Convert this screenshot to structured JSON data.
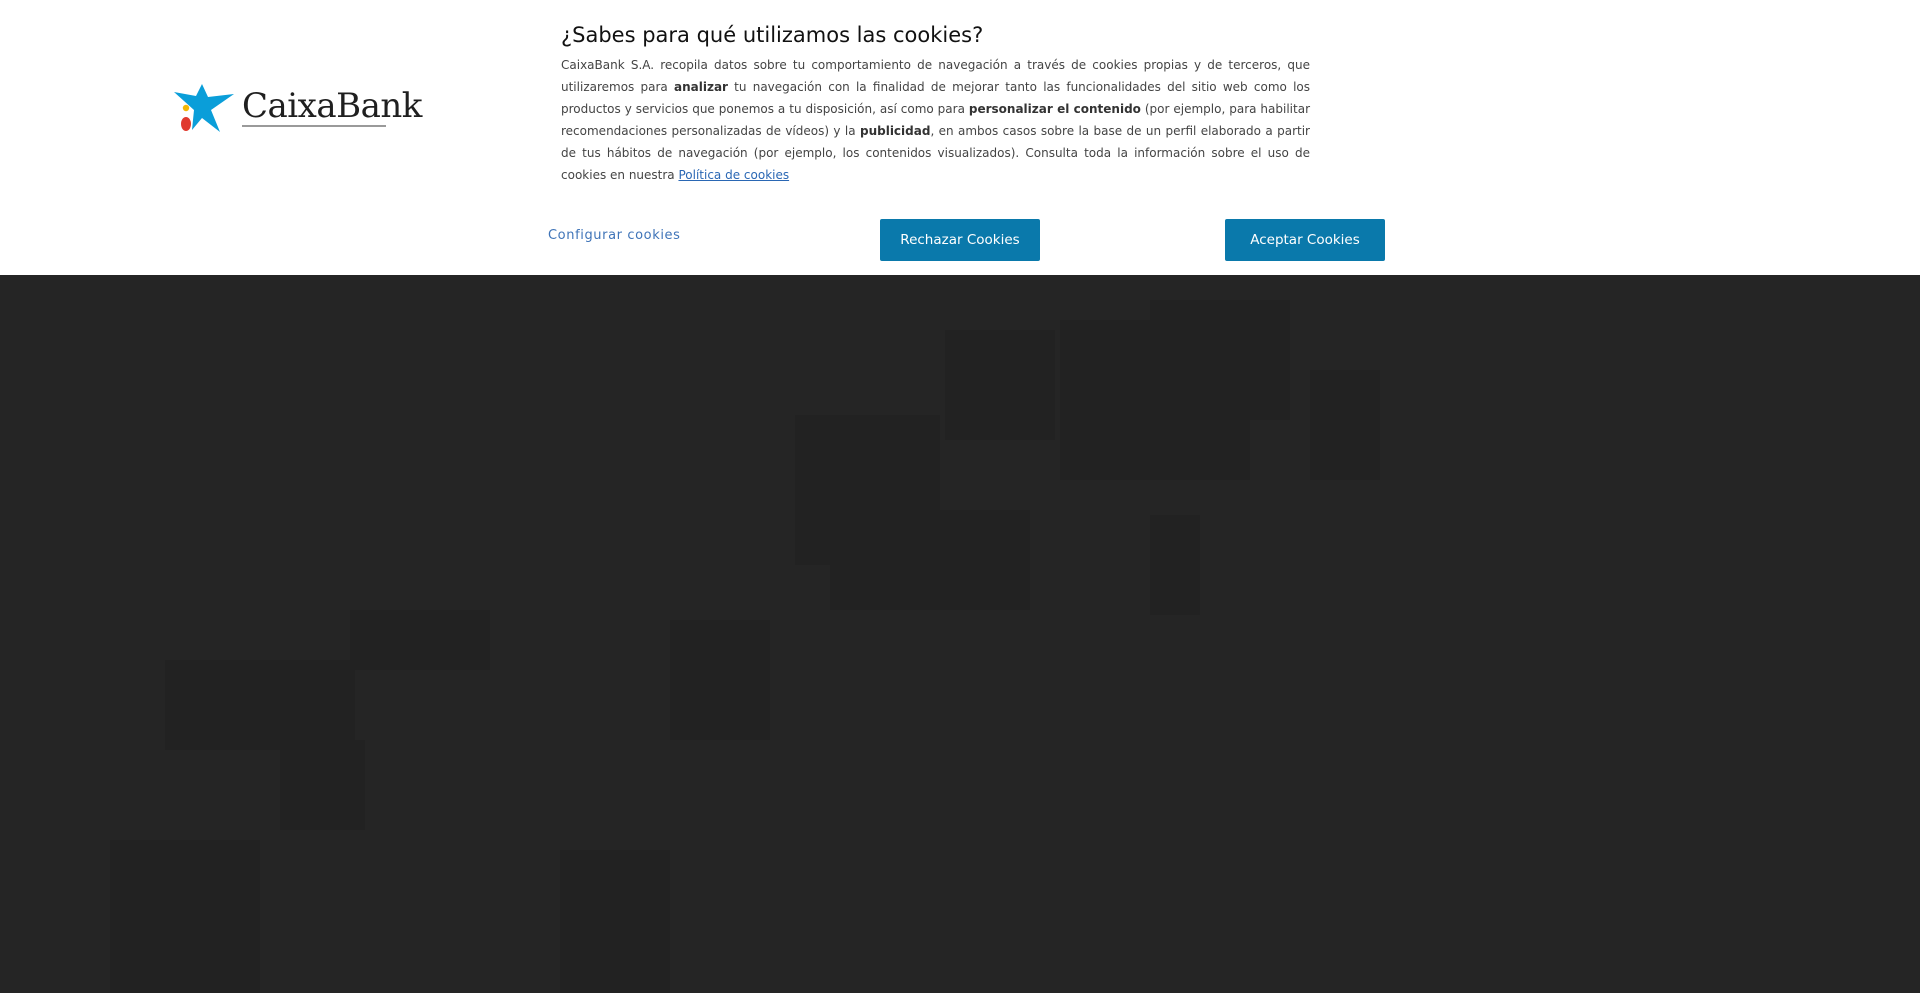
{
  "brand": {
    "name": "CaixaBank",
    "star_color": "#0a9ed9",
    "dot_red": "#e03a2e",
    "dot_yellow": "#f2b705",
    "dot_blue": "#0a9ed9"
  },
  "cookie_banner": {
    "title": "¿Sabes para qué utilizamos las cookies?",
    "description": {
      "p1": "CaixaBank S.A. recopila datos sobre tu comportamiento de navegación a través de cookies propias y de terceros, que utilizaremos para ",
      "b1": "analizar",
      "p2": " tu navegación con la finalidad de mejorar tanto las funcionalidades del sitio web como los productos y servicios que ponemos a tu disposición, así como para ",
      "b2": "personalizar el contenido",
      "p3": " (por ejemplo, para habilitar recomendaciones personalizadas de vídeos) y la ",
      "b3": "publicidad",
      "p4": ", en ambos casos sobre la base de un perfil elaborado a partir de tus hábitos de navegación (por ejemplo, los contenidos visualizados). Consulta toda la información sobre el uso de cookies en nuestra ",
      "link": "Política de cookies"
    },
    "configure_label": "Configurar cookies",
    "reject_label": "Rechazar Cookies",
    "accept_label": "Aceptar Cookies",
    "button_color": "#0a79ab",
    "link_color": "#3f74b8"
  },
  "overlay_color": "#252525"
}
